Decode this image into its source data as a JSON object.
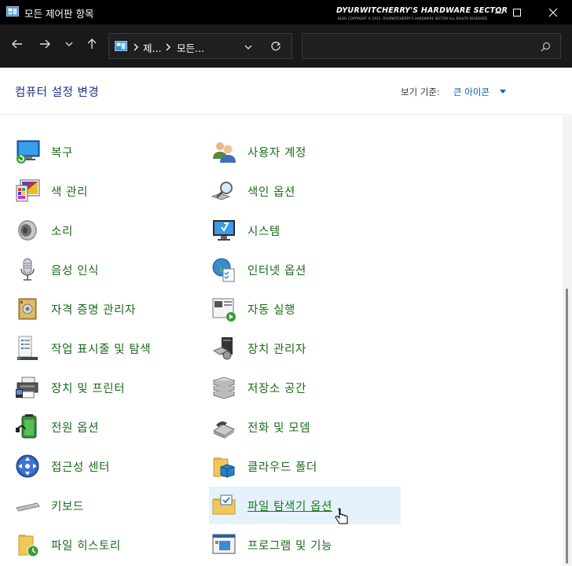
{
  "window": {
    "title": "모든 제어판 항목",
    "watermark": "DYURWITCHERRY'S HARDWARE SECTOR",
    "watermark_sub": "BLOG COPYRIGHT © 2015. DYURWITCHERRY'S HARDWARE SECTOR ALL RIGHTS RESERVED."
  },
  "address": {
    "crumbs": [
      "제...",
      "모든..."
    ]
  },
  "search": {
    "placeholder": ""
  },
  "header": {
    "title": "컴퓨터 설정 변경",
    "view_by_label": "보기 기준:",
    "view_by_value": "큰 아이콘"
  },
  "items_left": [
    {
      "label": "복구",
      "icon": "recovery-icon"
    },
    {
      "label": "색 관리",
      "icon": "color-management-icon"
    },
    {
      "label": "소리",
      "icon": "sound-icon"
    },
    {
      "label": "음성 인식",
      "icon": "speech-recognition-icon"
    },
    {
      "label": "자격 증명 관리자",
      "icon": "credential-manager-icon"
    },
    {
      "label": "작업 표시줄 및 탐색",
      "icon": "taskbar-icon"
    },
    {
      "label": "장치 및 프린터",
      "icon": "devices-printers-icon"
    },
    {
      "label": "전원 옵션",
      "icon": "power-options-icon"
    },
    {
      "label": "접근성 센터",
      "icon": "ease-of-access-icon"
    },
    {
      "label": "키보드",
      "icon": "keyboard-icon"
    },
    {
      "label": "파일 히스토리",
      "icon": "file-history-icon"
    }
  ],
  "items_right": [
    {
      "label": "사용자 계정",
      "icon": "user-accounts-icon"
    },
    {
      "label": "색인 옵션",
      "icon": "indexing-options-icon"
    },
    {
      "label": "시스템",
      "icon": "system-icon"
    },
    {
      "label": "인터넷 옵션",
      "icon": "internet-options-icon"
    },
    {
      "label": "자동 실행",
      "icon": "autoplay-icon"
    },
    {
      "label": "장치 관리자",
      "icon": "device-manager-icon"
    },
    {
      "label": "저장소 공간",
      "icon": "storage-spaces-icon"
    },
    {
      "label": "전화 및 모뎀",
      "icon": "phone-modem-icon"
    },
    {
      "label": "클라우드 폴더",
      "icon": "cloud-folder-icon"
    },
    {
      "label": "파일 탐색기 옵션",
      "icon": "file-explorer-options-icon"
    },
    {
      "label": "프로그램 및 기능",
      "icon": "programs-features-icon"
    }
  ]
}
